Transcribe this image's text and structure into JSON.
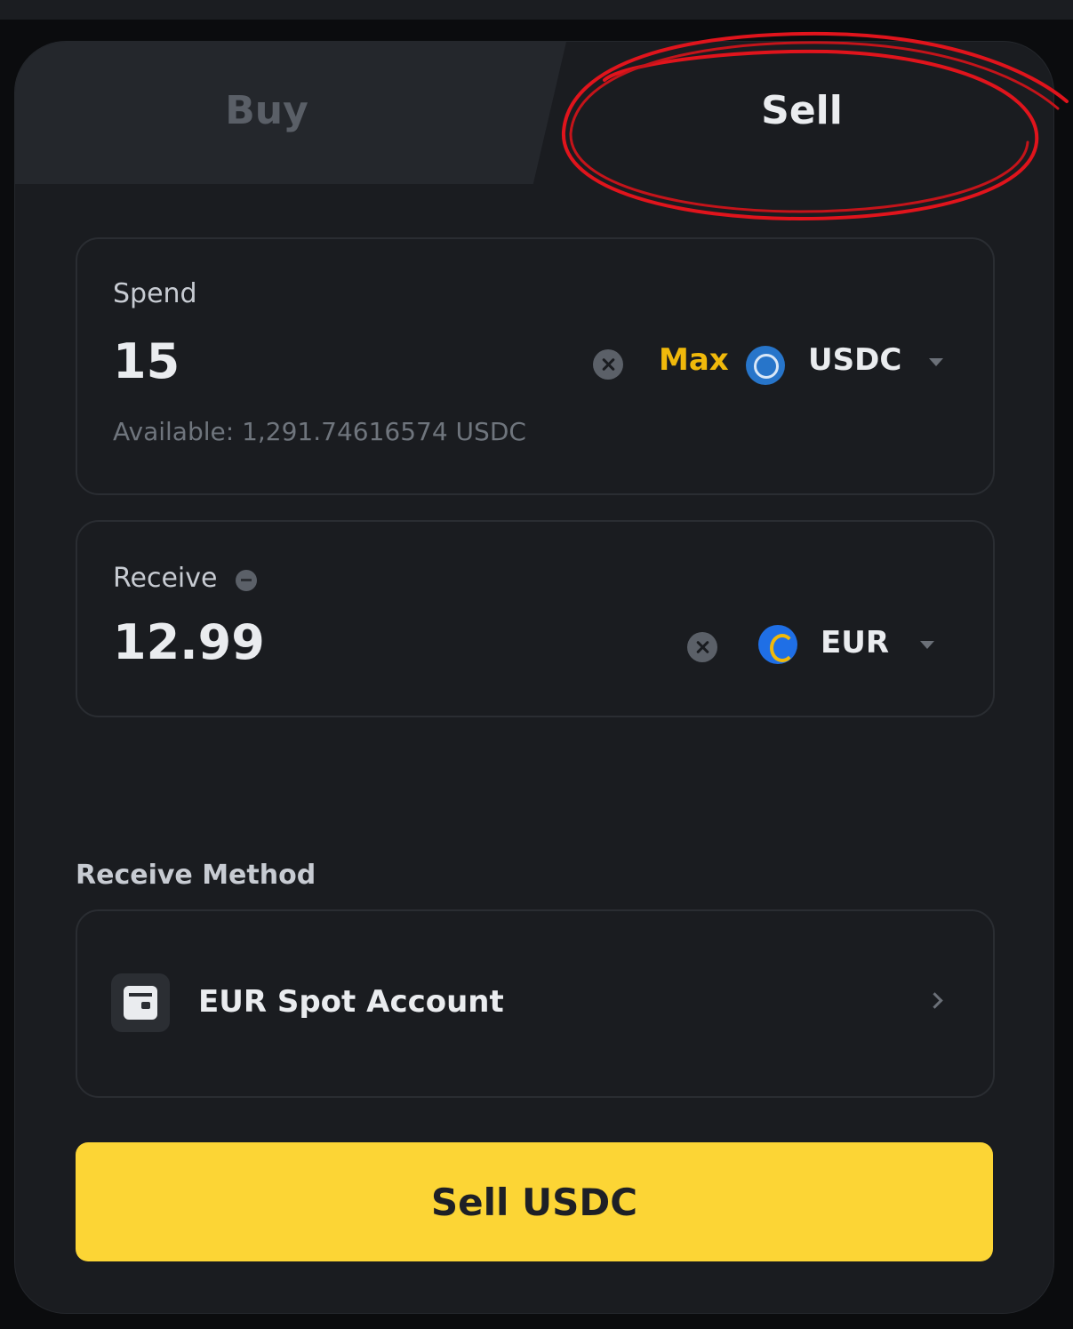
{
  "tabs": {
    "buy_label": "Buy",
    "sell_label": "Sell",
    "active": "Sell"
  },
  "spend": {
    "label": "Spend",
    "amount": "15",
    "max_label": "Max",
    "currency": "USDC",
    "available": "Available: 1,291.74616574 USDC"
  },
  "receive": {
    "label": "Receive",
    "amount": "12.99",
    "currency": "EUR"
  },
  "receive_method": {
    "title": "Receive Method",
    "account_label": "EUR Spot Account"
  },
  "action": {
    "submit_label": "Sell USDC"
  },
  "colors": {
    "accent_yellow": "#fcd535",
    "max_text": "#f0b90b",
    "annotation_red": "#e0141c",
    "background": "#1a1c20"
  },
  "icons": [
    "clear-icon",
    "usdc-coin-icon",
    "eur-coin-icon",
    "chevron-down-icon",
    "info-icon",
    "wallet-icon",
    "chevron-right-icon"
  ]
}
